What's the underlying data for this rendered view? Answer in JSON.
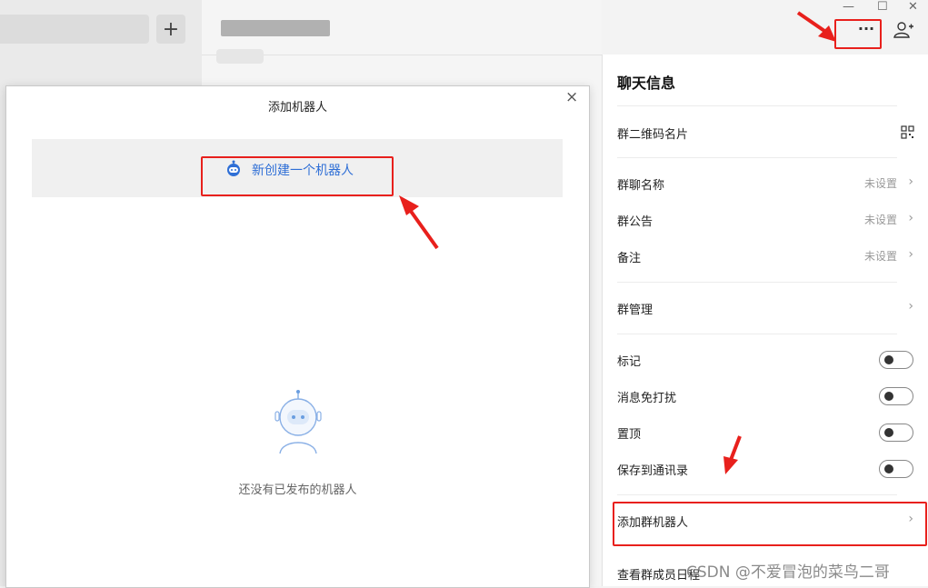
{
  "left": {
    "plus_label": "+"
  },
  "window": {
    "min": "—",
    "max": "☐",
    "close": "✕",
    "more": "···",
    "add_member_icon": "person-plus-icon"
  },
  "panel": {
    "title": "聊天信息",
    "qr_label": "群二维码名片",
    "name_label": "群聊名称",
    "name_value": "未设置",
    "notice_label": "群公告",
    "notice_value": "未设置",
    "remark_label": "备注",
    "remark_value": "未设置",
    "manage_label": "群管理",
    "mark_label": "标记",
    "mute_label": "消息免打扰",
    "pin_label": "置顶",
    "save_label": "保存到通讯录",
    "add_robot_label": "添加群机器人",
    "schedule_label": "查看群成员日程",
    "chevron": "›"
  },
  "modal": {
    "title": "添加机器人",
    "close": "×",
    "create_label": "新创建一个机器人",
    "empty_text": "还没有已发布的机器人"
  },
  "watermark": "CSDN @不爱冒泡的菜鸟二哥",
  "colors": {
    "accent": "#2f6fd6",
    "highlight": "#e8201c"
  }
}
